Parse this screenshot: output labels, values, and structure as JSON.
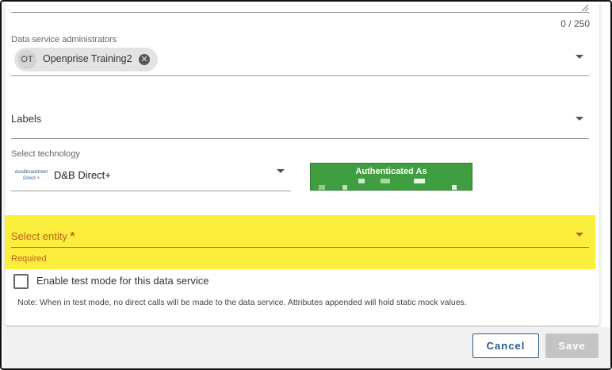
{
  "description_field": {
    "char_count": "0 / 250"
  },
  "administrators": {
    "label": "Data service administrators",
    "chips": [
      {
        "initials": "OT",
        "name": "Openprise Training2",
        "remove_icon": "close-circle-icon"
      }
    ]
  },
  "labels_field": {
    "placeholder": "Labels"
  },
  "technology": {
    "label": "Select technology",
    "logo_text": "dun&bradstreet Direct +",
    "selected": "D&B Direct+"
  },
  "auth": {
    "title": "Authenticated As"
  },
  "entity": {
    "label": "Select entity",
    "required_marker": "*",
    "error": "Required"
  },
  "test_mode": {
    "label": "Enable test mode for this data service",
    "checked": false,
    "note": "Note: When in test mode, no direct calls will be made to the data service. Attributes appended will hold static mock values."
  },
  "footer": {
    "cancel_label": "Cancel",
    "save_label": "Save"
  },
  "colors": {
    "highlight": "#fbee3c",
    "error": "#c0601a",
    "auth_green": "#3f9e3f",
    "primary": "#2b5a8a",
    "disabled": "#c4c4c4"
  }
}
